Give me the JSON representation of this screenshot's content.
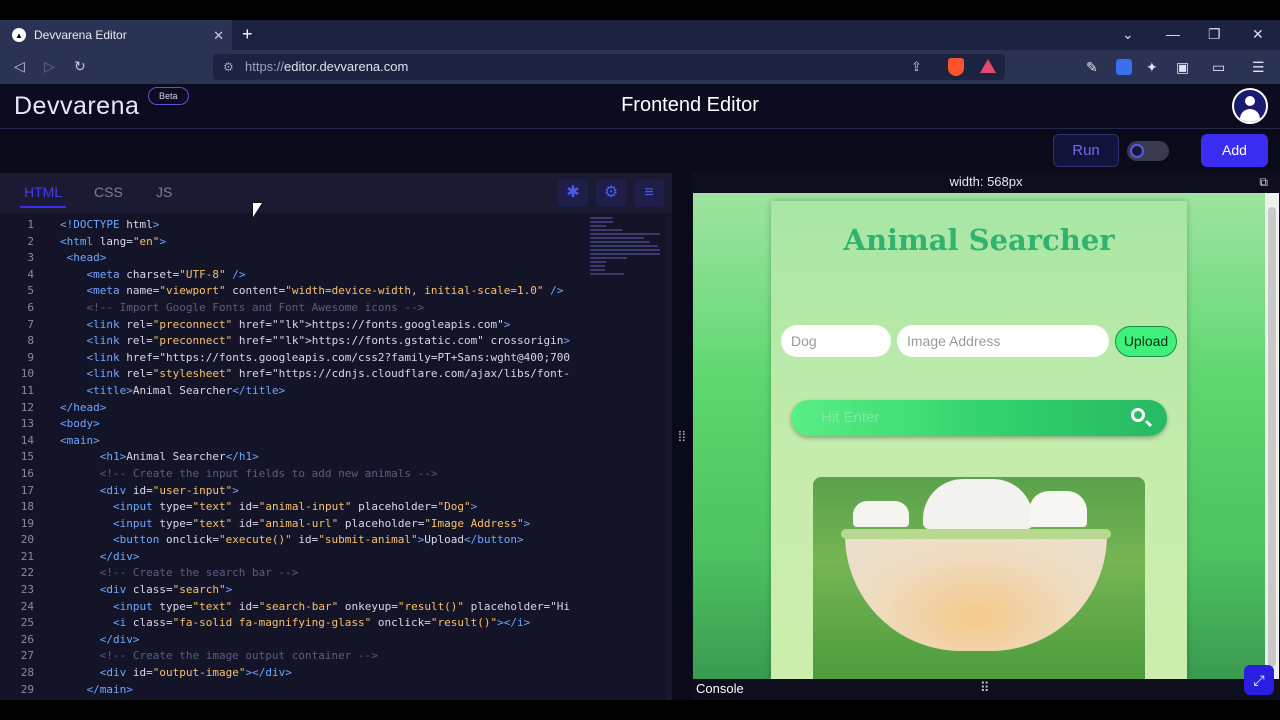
{
  "browser": {
    "tab_title": "Devvarena Editor",
    "url_prefix": "https://",
    "url_host": "editor.devvarena.com"
  },
  "app": {
    "logo_text": "Devvarena",
    "beta_badge": "Beta",
    "title": "Frontend Editor",
    "accent_color": "#3a2cf0"
  },
  "toolbar": {
    "run_label": "Run",
    "add_label": "Add"
  },
  "editor": {
    "tabs": [
      {
        "label": "HTML",
        "active": true
      },
      {
        "label": "CSS",
        "active": false
      },
      {
        "label": "JS",
        "active": false
      }
    ],
    "lines": [
      "<!DOCTYPE html>",
      "<html lang=\"en\">",
      " <head>",
      "    <meta charset=\"UTF-8\" />",
      "    <meta name=\"viewport\" content=\"width=device-width, initial-scale=1.0\" />",
      "    <!-- Import Google Fonts and Font Awesome icons -->",
      "    <link rel=\"preconnect\" href=\"https://fonts.googleapis.com\">",
      "    <link rel=\"preconnect\" href=\"https://fonts.gstatic.com\" crossorigin>",
      "    <link href=\"https://fonts.googleapis.com/css2?family=PT+Sans:wght@400;700",
      "    <link rel=\"stylesheet\" href=\"https://cdnjs.cloudflare.com/ajax/libs/font-",
      "    <title>Animal Searcher</title>",
      "</head>",
      "<body>",
      "<main>",
      "      <h1>Animal Searcher</h1>",
      "      <!-- Create the input fields to add new animals -->",
      "      <div id=\"user-input\">",
      "        <input type=\"text\" id=\"animal-input\" placeholder=\"Dog\">",
      "        <input type=\"text\" id=\"animal-url\" placeholder=\"Image Address\">",
      "        <button onclick=\"execute()\" id=\"submit-animal\">Upload</button>",
      "      </div>",
      "      <!-- Create the search bar -->",
      "      <div class=\"search\">",
      "        <input type=\"text\" id=\"search-bar\" onkeyup=\"result()\" placeholder=\"Hi",
      "        <i class=\"fa-solid fa-magnifying-glass\" onclick=\"result()\"></i>",
      "      </div>",
      "      <!-- Create the image output container -->",
      "      <div id=\"output-image\"></div>",
      "    </main>"
    ]
  },
  "preview": {
    "width_label": "width: 568px",
    "site_title": "Animal Searcher",
    "animal_placeholder": "Dog",
    "url_placeholder": "Image Address",
    "upload_label": "Upload",
    "search_placeholder": "Hit Enter",
    "console_label": "Console"
  }
}
